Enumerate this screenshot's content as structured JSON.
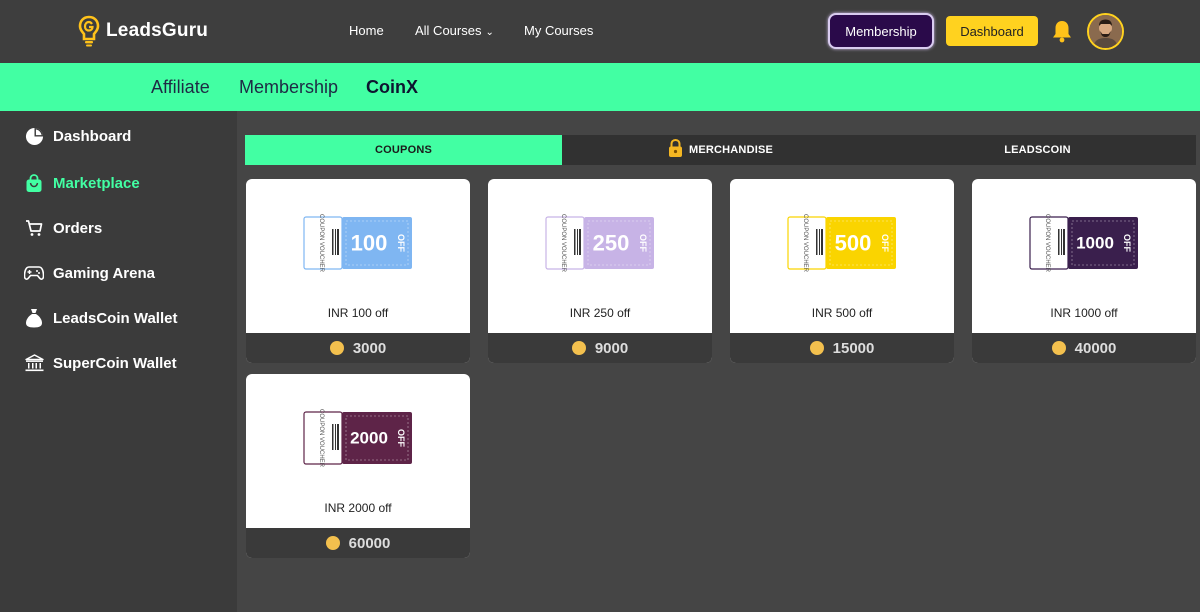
{
  "brand": {
    "name": "LeadsGuru"
  },
  "nav": {
    "home": "Home",
    "all_courses": "All Courses",
    "my_courses": "My Courses",
    "membership_button": "Membership",
    "dashboard_button": "Dashboard"
  },
  "subnav": {
    "items": [
      "Affiliate",
      "Membership",
      "CoinX"
    ],
    "active": "CoinX"
  },
  "sidebar": {
    "items": [
      {
        "label": "Dashboard",
        "icon": "pie-chart-icon"
      },
      {
        "label": "Marketplace",
        "icon": "shopping-bag-icon",
        "active": true
      },
      {
        "label": "Orders",
        "icon": "cart-icon"
      },
      {
        "label": "Gaming Arena",
        "icon": "gamepad-icon"
      },
      {
        "label": "LeadsCoin Wallet",
        "icon": "money-bag-icon"
      },
      {
        "label": "SuperCoin Wallet",
        "icon": "bank-icon"
      }
    ]
  },
  "tabs": {
    "items": [
      "COUPONS",
      "MERCHANDISE",
      "LEADSCOIN"
    ],
    "active": "COUPONS"
  },
  "coupons": [
    {
      "amount": "100",
      "off": "OFF",
      "stub": "COUPON VOUCHER",
      "name": "INR 100 off",
      "price": "3000",
      "color": "#7fb6f2"
    },
    {
      "amount": "250",
      "off": "OFF",
      "stub": "COUPON VOUCHER",
      "name": "INR 250 off",
      "price": "9000",
      "color": "#c7b3e6"
    },
    {
      "amount": "500",
      "off": "OFF",
      "stub": "COUPON VOUCHER",
      "name": "INR 500 off",
      "price": "15000",
      "color": "#fad400"
    },
    {
      "amount": "1000",
      "off": "OFF",
      "stub": "COUPON VOUCHER",
      "name": "INR 1000 off",
      "price": "40000",
      "color": "#3a1f4d"
    },
    {
      "amount": "2000",
      "off": "OFF",
      "stub": "COUPON VOUCHER",
      "name": "INR 2000 off",
      "price": "60000",
      "color": "#5e2448"
    }
  ],
  "colors": {
    "accent": "#42ffa3",
    "gold": "#ffd21f",
    "coin": "#f3c04e"
  }
}
